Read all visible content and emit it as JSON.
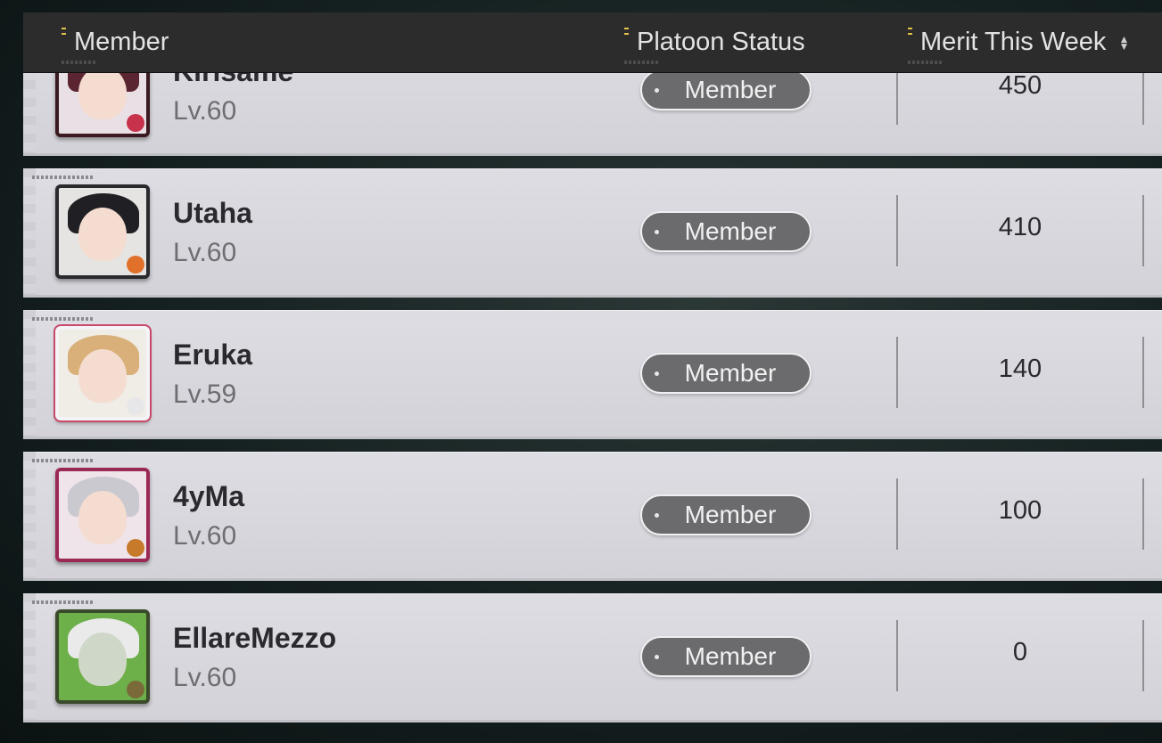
{
  "header": {
    "member_label": "Member",
    "status_label": "Platoon Status",
    "merit_label": "Merit This Week"
  },
  "members": [
    {
      "name": "Kirisame",
      "level": "Lv.60",
      "status": "Member",
      "merit": "450",
      "hair": "#5a2430",
      "frame": "#3a1a20",
      "badge": "#c8324a"
    },
    {
      "name": "Utaha",
      "level": "Lv.60",
      "status": "Member",
      "merit": "410",
      "hair": "#1f1f24",
      "frame": "#2a2a2e",
      "badge": "#e0702a"
    },
    {
      "name": "Eruka",
      "level": "Lv.59",
      "status": "Member",
      "merit": "140",
      "hair": "#d9b07a",
      "frame": "#f4f4f6",
      "badge": "#e7e7ea"
    },
    {
      "name": "4yMa",
      "level": "Lv.60",
      "status": "Member",
      "merit": "100",
      "hair": "#c9c9cf",
      "frame": "#9a2a55",
      "badge": "#c77a2a"
    },
    {
      "name": "EllareMezzo",
      "level": "Lv.60",
      "status": "Member",
      "merit": "0",
      "hair": "#eaeaea",
      "frame": "#3a4a2a",
      "badge": "#7a6a3a"
    }
  ]
}
